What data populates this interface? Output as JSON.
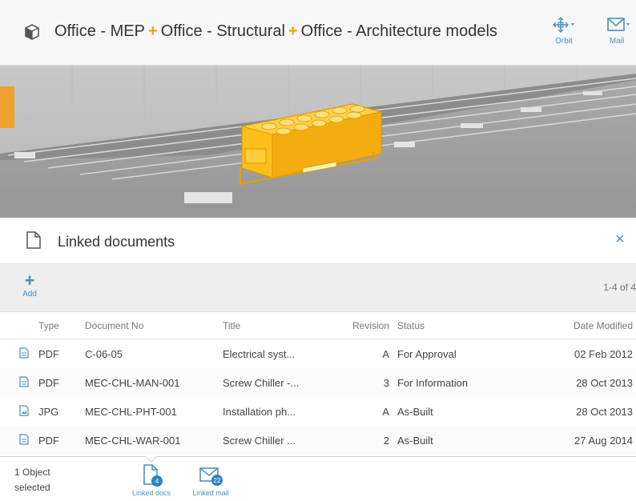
{
  "header": {
    "model_parts": [
      "Office - MEP",
      "Office - Structural",
      "Office - Architecture models"
    ],
    "separator": "+",
    "tools": [
      {
        "label": "Orbit",
        "icon": "orbit-icon"
      },
      {
        "label": "Mail",
        "icon": "mail-icon"
      }
    ]
  },
  "panel": {
    "title": "Linked documents",
    "close_label": "×",
    "add_label": "Add",
    "count": "1-4 of 4",
    "columns": {
      "type": "Type",
      "document_no": "Document No",
      "title": "Title",
      "revision": "Revision",
      "status": "Status",
      "date_modified": "Date Modified"
    },
    "rows": [
      {
        "type": "PDF",
        "document_no": "C-06-05",
        "title": "Electrical syst...",
        "revision": "A",
        "status": "For Approval",
        "date_modified": "02 Feb 2012"
      },
      {
        "type": "PDF",
        "document_no": "MEC-CHL-MAN-001",
        "title": "Screw Chiller -...",
        "revision": "3",
        "status": "For Information",
        "date_modified": "28 Oct 2013"
      },
      {
        "type": "JPG",
        "document_no": "MEC-CHL-PHT-001",
        "title": "Installation ph...",
        "revision": "A",
        "status": "As-Built",
        "date_modified": "28 Oct 2013"
      },
      {
        "type": "PDF",
        "document_no": "MEC-CHL-WAR-001",
        "title": "Screw Chiller ...",
        "revision": "2",
        "status": "As-Built",
        "date_modified": "27 Aug 2014"
      }
    ]
  },
  "footer": {
    "selection_line1": "1 Object",
    "selection_line2": "selected",
    "tabs": [
      {
        "label": "Linked docs",
        "badge": "4"
      },
      {
        "label": "Linked mail",
        "badge": "22"
      }
    ]
  },
  "colors": {
    "accent": "#4a90c2",
    "highlight": "#f5a200",
    "selected_object": "#ffbf1a"
  }
}
